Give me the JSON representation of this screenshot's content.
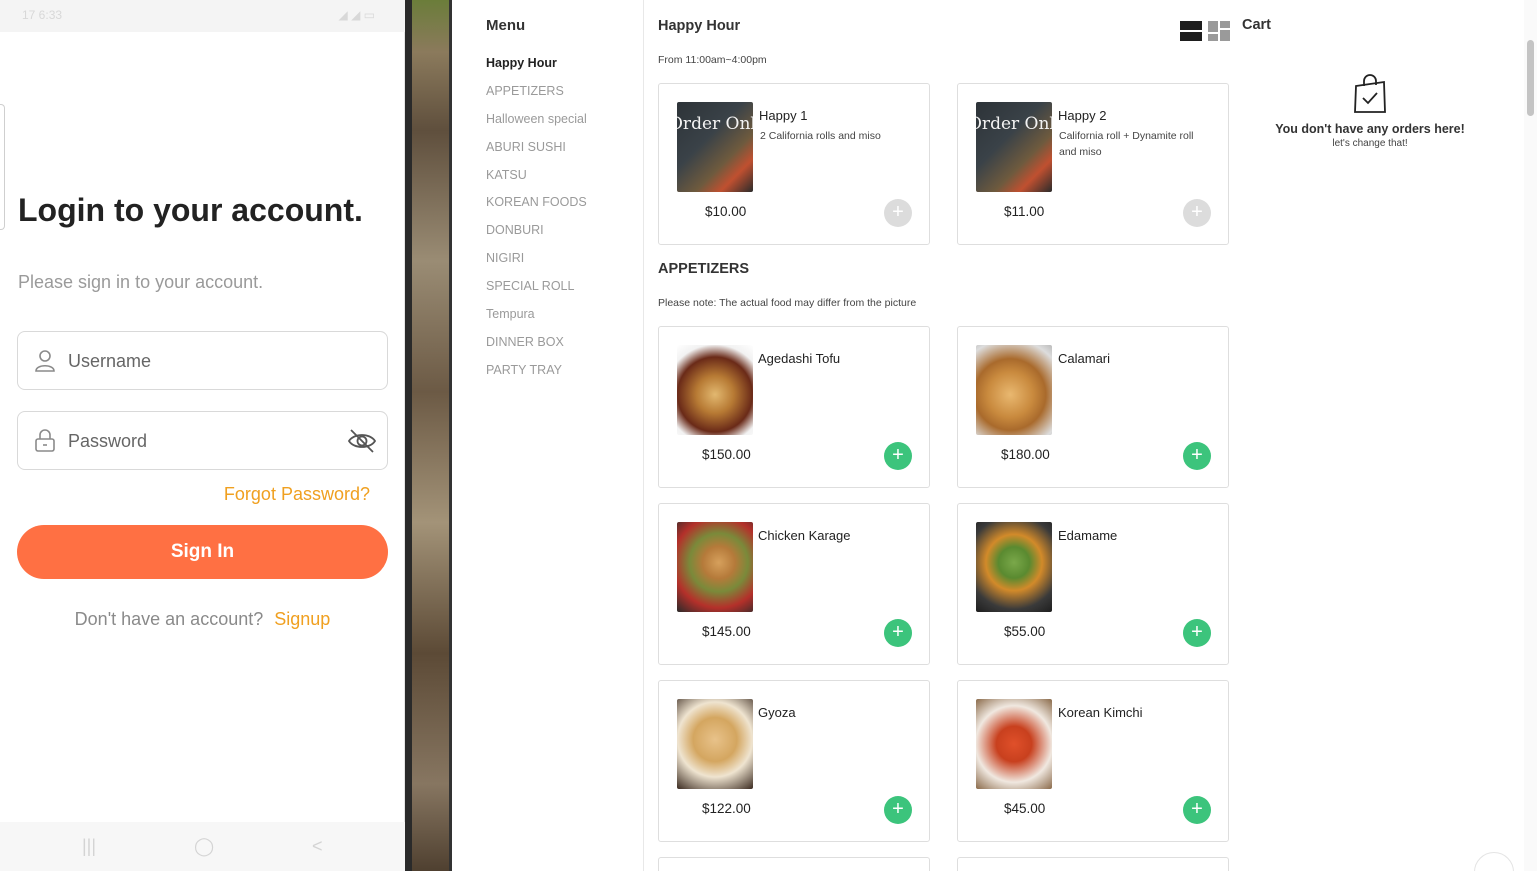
{
  "phone": {
    "status_time": "17 6:33",
    "status_right": "◢ ◢ ▭",
    "login": {
      "title": "Login to your account.",
      "subtitle": "Please sign in to your account.",
      "username_placeholder": "Username",
      "password_placeholder": "Password",
      "forgot_password": "Forgot Password?",
      "sign_in": "Sign In",
      "no_account": "Don't have an account?",
      "signup": "Signup"
    },
    "navbar": {
      "recents": "|||",
      "home": "◯",
      "back": "<"
    }
  },
  "menu": {
    "title": "Menu",
    "items": [
      "Happy Hour",
      "APPETIZERS",
      "Halloween special",
      "ABURI SUSHI",
      "KATSU",
      "KOREAN FOODS",
      "DONBURI",
      "NIGIRI",
      "SPECIAL ROLL",
      "Tempura",
      "DINNER BOX",
      "PARTY TRAY"
    ],
    "active": "Happy Hour"
  },
  "happy_hour": {
    "title": "Happy Hour",
    "note": "From 11:00am~4:00pm",
    "items": [
      {
        "name": "Happy 1",
        "desc": "2 California rolls and miso",
        "price": "$10.00",
        "image_text": "Order Online",
        "add": "+"
      },
      {
        "name": "Happy 2",
        "desc": "California roll + Dynamite roll and miso",
        "price": "$11.00",
        "image_text": "Order Online",
        "add": "+"
      }
    ]
  },
  "appetizers": {
    "title": "APPETIZERS",
    "note": "Please note: The actual food may differ from the picture",
    "items": [
      {
        "name": "Agedashi Tofu",
        "price": "$150.00",
        "add": "+"
      },
      {
        "name": "Calamari",
        "price": "$180.00",
        "add": "+"
      },
      {
        "name": "Chicken Karage",
        "price": "$145.00",
        "add": "+"
      },
      {
        "name": "Edamame",
        "price": "$55.00",
        "add": "+"
      },
      {
        "name": "Gyoza",
        "price": "$122.00",
        "add": "+"
      },
      {
        "name": "Korean Kimchi",
        "price": "$45.00",
        "add": "+"
      }
    ]
  },
  "cart": {
    "label": "Cart",
    "empty_title": "You don't have any orders here!",
    "empty_sub": "let's change that!"
  },
  "colors": {
    "accent_orange": "#ff7043",
    "link_yellow": "#f0a020",
    "add_green": "#3cc47c",
    "add_disabled": "#dcdcdc"
  },
  "icons": {
    "username_field": "user-icon",
    "password_field": "lock-icon",
    "password_toggle": "eye-off-icon",
    "list_view": "list-view-icon",
    "grid_view": "grid-view-icon",
    "cart_empty": "shopping-bag-check-icon"
  }
}
